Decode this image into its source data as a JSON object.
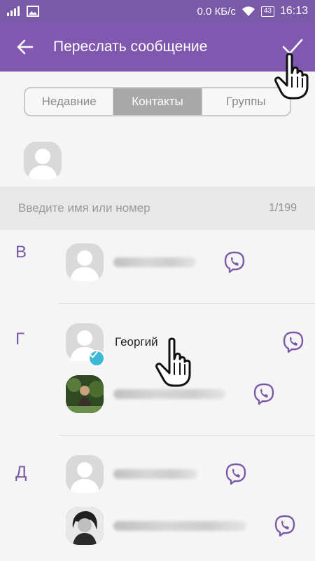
{
  "status_bar": {
    "network_speed": "0.0 КБ/с",
    "battery": "43",
    "time": "16:13"
  },
  "app_bar": {
    "title": "Переслать сообщение",
    "back_icon": "arrow-left-icon",
    "confirm_icon": "checkmark-icon"
  },
  "tabs": [
    {
      "label": "Недавние",
      "active": false
    },
    {
      "label": "Контакты",
      "active": true
    },
    {
      "label": "Группы",
      "active": false
    }
  ],
  "search": {
    "placeholder": "Введите имя или номер",
    "count": "1/199"
  },
  "sections": [
    {
      "letter": "В"
    },
    {
      "letter": "Г"
    },
    {
      "letter": "Д"
    }
  ],
  "contacts": {
    "georgiy": {
      "name": "Георгий",
      "selected": true
    }
  },
  "colors": {
    "accent": "#8058b0",
    "status_bar": "#7a5aa8",
    "check_badge": "#3db7d6"
  }
}
